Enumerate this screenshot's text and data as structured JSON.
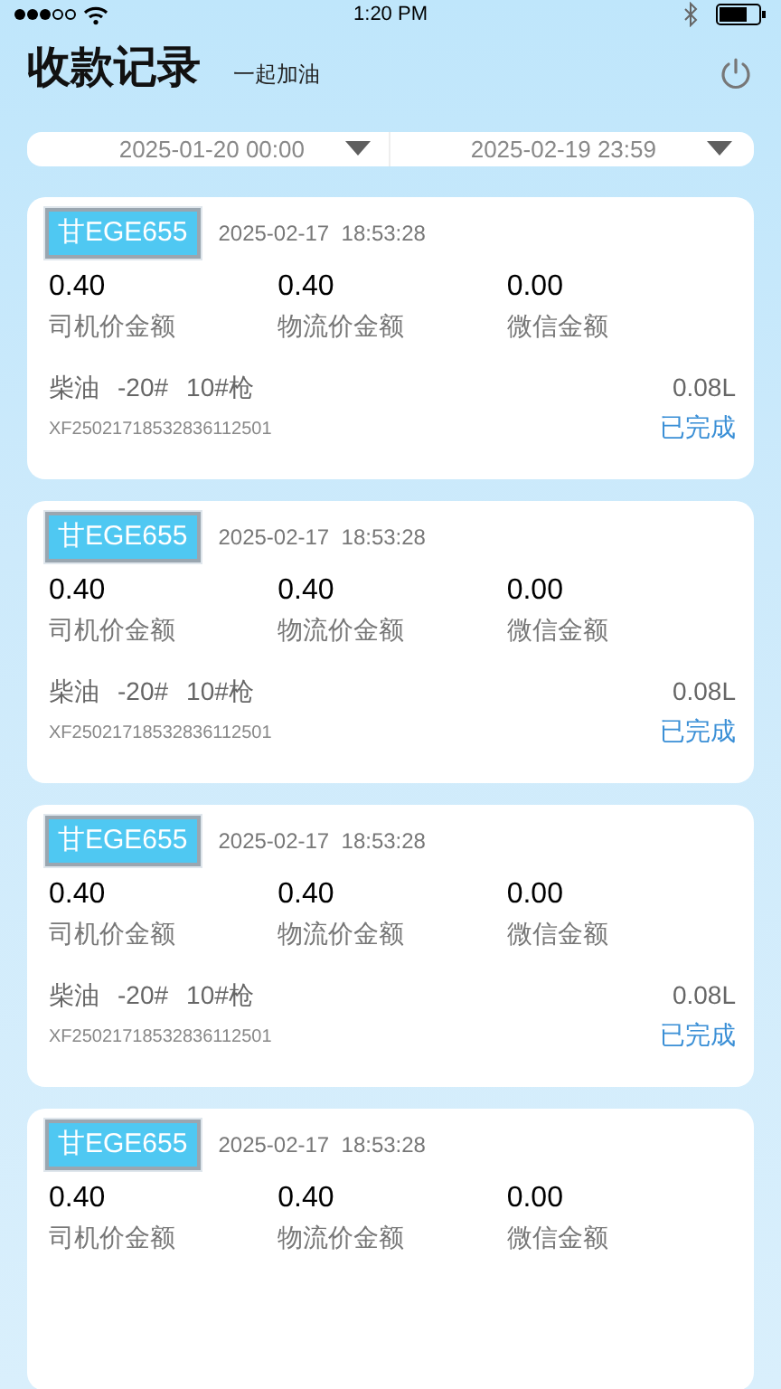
{
  "status_bar": {
    "time": "1:20 PM",
    "signal_dots": [
      {
        "on": true
      },
      {
        "on": true
      },
      {
        "on": true
      },
      {
        "on": false
      },
      {
        "on": false
      }
    ]
  },
  "header": {
    "title": "收款记录",
    "subtitle": "一起加油"
  },
  "date_range": {
    "start": "2025-01-20 00:00",
    "end": "2025-02-19 23:59"
  },
  "records": [
    {
      "plate": "甘EGE655",
      "time": "2025-02-17  18:53:28",
      "amounts": [
        {
          "value": "0.40",
          "label": "司机价金额"
        },
        {
          "value": "0.40",
          "label": "物流价金额"
        },
        {
          "value": "0.00",
          "label": "微信金额"
        }
      ],
      "fuel": [
        "柴油",
        "-20#",
        "10#枪"
      ],
      "volume": "0.08L",
      "order_no": "XF25021718532836112501",
      "status": "已完成"
    },
    {
      "plate": "甘EGE655",
      "time": "2025-02-17  18:53:28",
      "amounts": [
        {
          "value": "0.40",
          "label": "司机价金额"
        },
        {
          "value": "0.40",
          "label": "物流价金额"
        },
        {
          "value": "0.00",
          "label": "微信金额"
        }
      ],
      "fuel": [
        "柴油",
        "-20#",
        "10#枪"
      ],
      "volume": "0.08L",
      "order_no": "XF25021718532836112501",
      "status": "已完成"
    },
    {
      "plate": "甘EGE655",
      "time": "2025-02-17  18:53:28",
      "amounts": [
        {
          "value": "0.40",
          "label": "司机价金额"
        },
        {
          "value": "0.40",
          "label": "物流价金额"
        },
        {
          "value": "0.00",
          "label": "微信金额"
        }
      ],
      "fuel": [
        "柴油",
        "-20#",
        "10#枪"
      ],
      "volume": "0.08L",
      "order_no": "XF25021718532836112501",
      "status": "已完成"
    },
    {
      "plate": "甘EGE655",
      "time": "2025-02-17  18:53:28",
      "amounts": [
        {
          "value": "0.40",
          "label": "司机价金额"
        },
        {
          "value": "0.40",
          "label": "物流价金额"
        },
        {
          "value": "0.00",
          "label": "微信金额"
        }
      ]
    }
  ]
}
